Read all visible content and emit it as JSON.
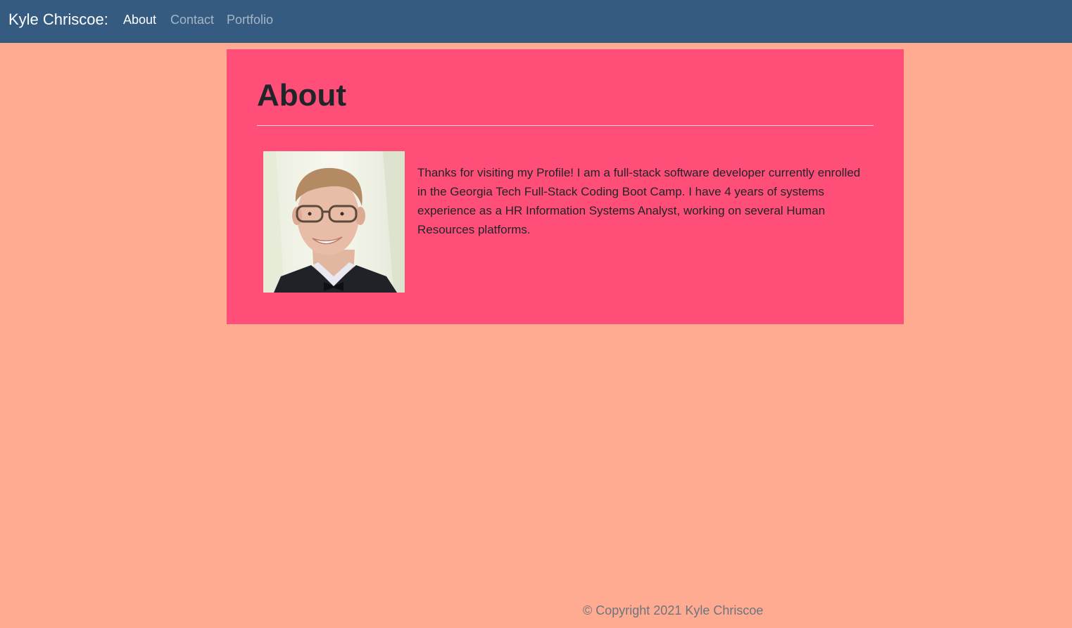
{
  "navbar": {
    "brand": "Kyle Chriscoe:",
    "links": [
      {
        "label": "About",
        "active": true
      },
      {
        "label": "Contact",
        "active": false
      },
      {
        "label": "Portfolio",
        "active": false
      }
    ]
  },
  "about": {
    "title": "About",
    "bio": "Thanks for visiting my Profile! I am a full-stack software developer currently enrolled in the Georgia Tech Full-Stack Coding Boot Camp. I have 4 years of systems experience as a HR Information Systems Analyst, working on several Human Resources platforms."
  },
  "footer": {
    "copyright": "© Copyright 2021 Kyle Chriscoe"
  },
  "colors": {
    "page_background": "#FFAB91",
    "navbar_background": "#355B80",
    "card_background": "#FF4F79",
    "text_dark": "#212529",
    "footer_text": "#6C757D"
  }
}
